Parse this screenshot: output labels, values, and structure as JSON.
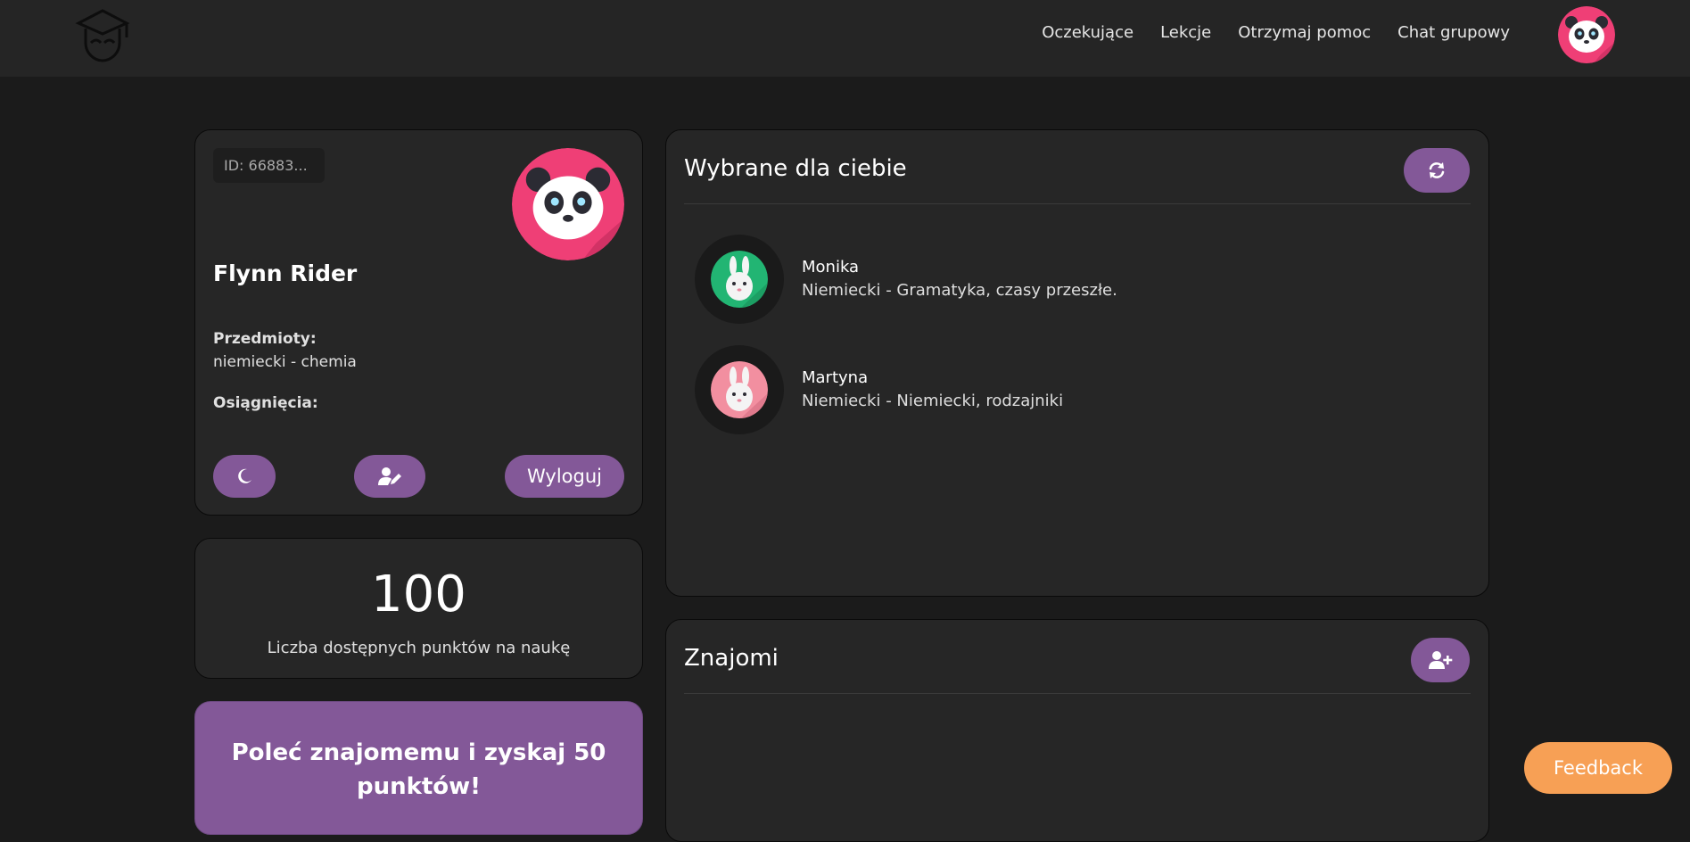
{
  "nav": {
    "items": [
      "Oczekujące",
      "Lekcje",
      "Otrzymaj pomoc",
      "Chat grupowy"
    ]
  },
  "profile": {
    "id": "ID: 66883...",
    "name": "Flynn Rider",
    "subjects_label": "Przedmioty:",
    "subjects_value": "niemiecki - chemia",
    "achievements_label": "Osiągnięcia:",
    "logout_label": "Wyloguj"
  },
  "points": {
    "value": "100",
    "label": "Liczba dostępnych punktów na naukę"
  },
  "refer": {
    "text": "Poleć znajomemu i zyskaj 50 punktów!"
  },
  "picked": {
    "title": "Wybrane dla ciebie",
    "people": [
      {
        "name": "Monika",
        "desc": "Niemiecki - Gramatyka, czasy przeszłe."
      },
      {
        "name": "Martyna",
        "desc": "Niemiecki - Niemiecki, rodzajniki"
      }
    ]
  },
  "friends": {
    "title": "Znajomi"
  },
  "feedback_label": "Feedback",
  "colors": {
    "accent": "#835898",
    "background": "#1b1b1b",
    "card": "#262626",
    "feedback": "#f7a055",
    "panda_bg": "#ef3f76",
    "bunny_green": "#22b573",
    "bunny_pink": "#f28fa0"
  }
}
